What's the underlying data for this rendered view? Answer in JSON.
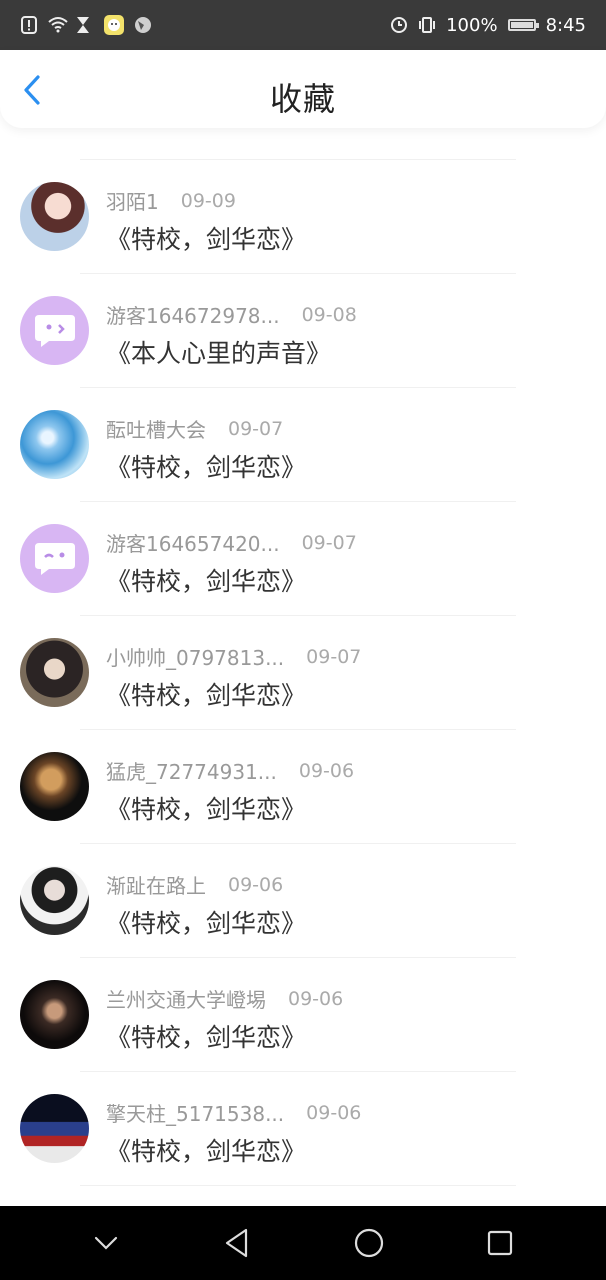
{
  "status_bar": {
    "battery_percent": "100%",
    "time": "8:45"
  },
  "header": {
    "title": "收藏"
  },
  "items": [
    {
      "name": "羽陌1",
      "date": "09-09",
      "book": "《特校，剑华恋》",
      "avatar": "girl-avatar"
    },
    {
      "name": "游客164672978...",
      "date": "09-08",
      "book": "《本人心里的声音》",
      "avatar": "chat-bubble-avatar"
    },
    {
      "name": "酝吐槽大会",
      "date": "09-07",
      "book": "《特校，剑华恋》",
      "avatar": "blue-texture-avatar"
    },
    {
      "name": "游客164657420...",
      "date": "09-07",
      "book": "《特校，剑华恋》",
      "avatar": "chat-bubble-avatar"
    },
    {
      "name": "小帅帅_0797813...",
      "date": "09-07",
      "book": "《特校，剑华恋》",
      "avatar": "anime-boy-avatar"
    },
    {
      "name": "猛虎_72774931...",
      "date": "09-06",
      "book": "《特校，剑华恋》",
      "avatar": "tiger-avatar"
    },
    {
      "name": "渐趾在路上",
      "date": "09-06",
      "book": "《特校，剑华恋》",
      "avatar": "girl-photo-avatar"
    },
    {
      "name": "兰州交通大学嶝埸",
      "date": "09-06",
      "book": "《特校，剑华恋》",
      "avatar": "dark-portrait-avatar"
    },
    {
      "name": "擎天柱_5171538...",
      "date": "09-06",
      "book": "《特校，剑华恋》",
      "avatar": "street-scene-avatar"
    }
  ],
  "colors": {
    "accent": "#2b8ff0",
    "chat_avatar_bg": "#d8b6f3"
  }
}
